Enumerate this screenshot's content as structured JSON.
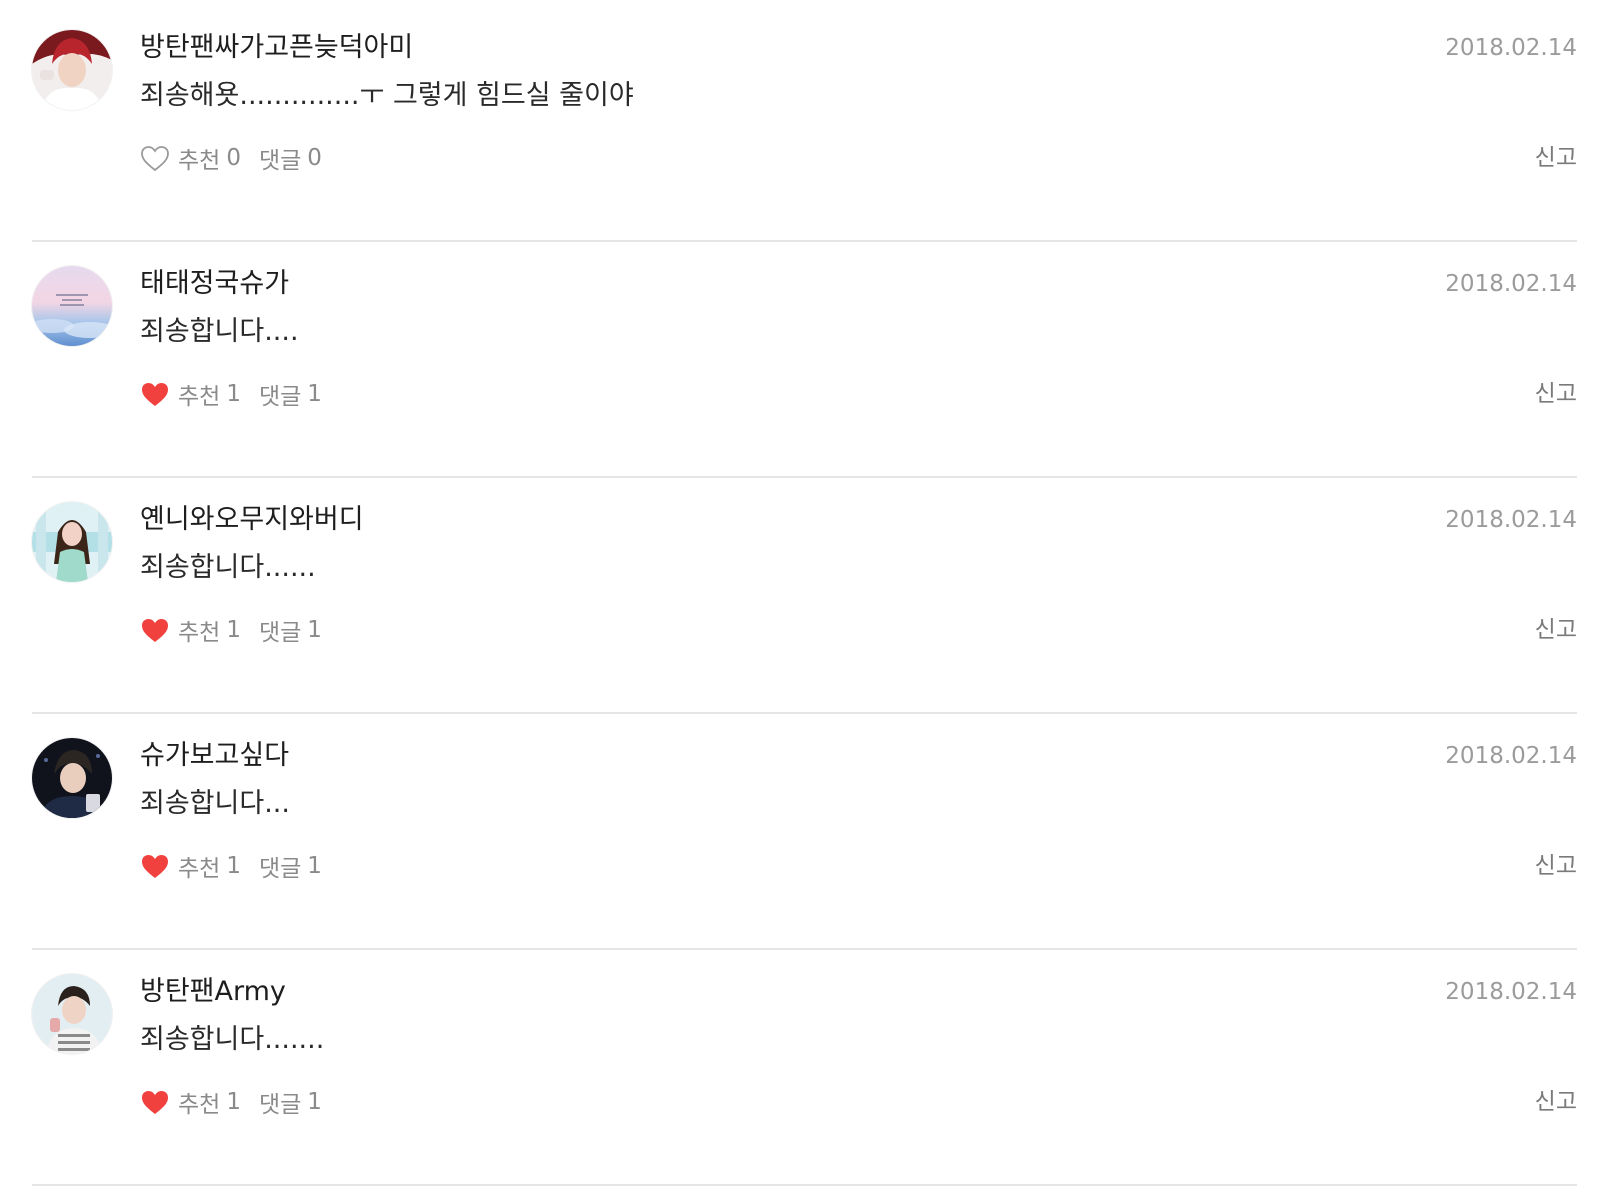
{
  "colors": {
    "heart_liked": "#f0413f",
    "heart_outline": "#9a9a9a",
    "date": "#9b9b9b",
    "divider": "#e6e6e6"
  },
  "comments": [
    {
      "username": "방탄팬싸가고픈늦덕아미",
      "date": "2018.02.14",
      "text": "죄송해욧..............ㅜ 그렇게 힘드실 줄이야",
      "like_label": "추천",
      "like_count": "0",
      "reply_label": "댓글",
      "reply_count": "0",
      "report_label": "신고",
      "liked": false,
      "heart_icon": "heart-outline-icon"
    },
    {
      "username": "태태정국슈가",
      "date": "2018.02.14",
      "text": "죄송합니다....",
      "like_label": "추천",
      "like_count": "1",
      "reply_label": "댓글",
      "reply_count": "1",
      "report_label": "신고",
      "liked": true,
      "heart_icon": "heart-filled-icon"
    },
    {
      "username": "옌니와오무지와버디",
      "date": "2018.02.14",
      "text": "죄송합니다......",
      "like_label": "추천",
      "like_count": "1",
      "reply_label": "댓글",
      "reply_count": "1",
      "report_label": "신고",
      "liked": true,
      "heart_icon": "heart-filled-icon"
    },
    {
      "username": "슈가보고싶다",
      "date": "2018.02.14",
      "text": "죄송합니다...",
      "like_label": "추천",
      "like_count": "1",
      "reply_label": "댓글",
      "reply_count": "1",
      "report_label": "신고",
      "liked": true,
      "heart_icon": "heart-filled-icon"
    },
    {
      "username": "방탄팬Army",
      "date": "2018.02.14",
      "text": "죄송합니다.......",
      "like_label": "추천",
      "like_count": "1",
      "reply_label": "댓글",
      "reply_count": "1",
      "report_label": "신고",
      "liked": true,
      "heart_icon": "heart-filled-icon"
    }
  ]
}
